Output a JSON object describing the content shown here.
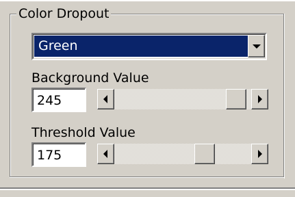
{
  "group": {
    "title": "Color Dropout"
  },
  "color_select": {
    "value": "Green"
  },
  "background": {
    "label": "Background Value",
    "value": "245",
    "range": [
      0,
      255
    ]
  },
  "threshold": {
    "label": "Threshold Value",
    "value": "175",
    "range": [
      0,
      255
    ]
  },
  "icons": {
    "dropdown": "chevron-down-icon",
    "scroll_left": "arrow-left-icon",
    "scroll_right": "arrow-right-icon"
  },
  "colors": {
    "face": "#d4d0c8",
    "selection": "#0a246a",
    "selection_text": "#ffffff"
  }
}
